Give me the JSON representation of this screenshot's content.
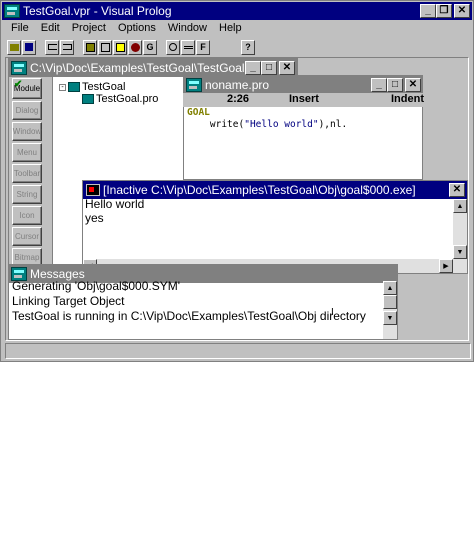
{
  "main_window": {
    "title": "TestGoal.vpr - Visual Prolog"
  },
  "menu": [
    "File",
    "Edit",
    "Project",
    "Options",
    "Window",
    "Help"
  ],
  "toolbar": {
    "group1": [
      "",
      ""
    ],
    "group2": [
      "",
      ""
    ],
    "group3": [
      "",
      "",
      "",
      "",
      "G"
    ],
    "group4": [
      "",
      "",
      "F"
    ],
    "group5": [
      "?"
    ]
  },
  "project_window": {
    "title": "C:\\Vip\\Doc\\Examples\\TestGoal\\TestGoal.vpr",
    "module_buttons": [
      "Module",
      "Dialog",
      "Window",
      "Menu",
      "Toolbar",
      "String",
      "Icon",
      "Cursor",
      "Bitmap"
    ],
    "tree": {
      "root": "TestGoal",
      "child": "TestGoal.pro",
      "expander": "-"
    }
  },
  "editor_window": {
    "title": "noname.pro",
    "status": {
      "position": "2:26",
      "mode": "Insert",
      "indent": "Indent"
    },
    "code": {
      "keyword": "GOAL",
      "indent": "    ",
      "call": "write(",
      "string": "\"Hello world\"",
      "rest": "),nl."
    }
  },
  "exe_window": {
    "title": "[Inactive C:\\Vip\\Doc\\Examples\\TestGoal\\Obj\\goal$000.exe]",
    "lines": [
      "Hello world",
      "yes"
    ]
  },
  "messages_window": {
    "title": "Messages",
    "lines": [
      "Generating 'Obj\\goal$000.SYM'",
      "Linking Target Object",
      "TestGoal is running in C:\\Vip\\Doc\\Examples\\TestGoal\\Obj directory"
    ]
  },
  "caption_buttons": {
    "minimize": "_",
    "maximize": "□",
    "close": "✕",
    "restore": "❐"
  },
  "colors": {
    "active_title": "#000080",
    "inactive_title": "#808080",
    "face": "#c0c0c0",
    "check": "#008000",
    "keyword": "#808000"
  }
}
